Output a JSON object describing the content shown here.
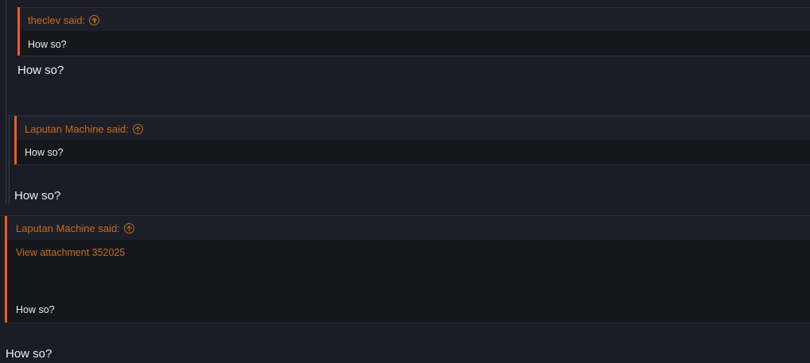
{
  "quote_1": {
    "author_label": "theclev said:",
    "text": "How so?"
  },
  "reply_1": "How so?",
  "quote_2": {
    "author_label": "Laputan Machine said:",
    "text": "How so?"
  },
  "reply_2": "How so?",
  "quote_3": {
    "author_label": "Laputan Machine said:",
    "attachment_link": "View attachment 352025",
    "text": "How so?"
  },
  "reply_3": "How so?",
  "colors": {
    "background": "#1b1d26",
    "quote_body": "#16171d",
    "quote_accent": "#f05a28",
    "link": "#c66d1a",
    "text": "#eceef2"
  },
  "icons": [
    "up-arrow-circle-icon"
  ]
}
